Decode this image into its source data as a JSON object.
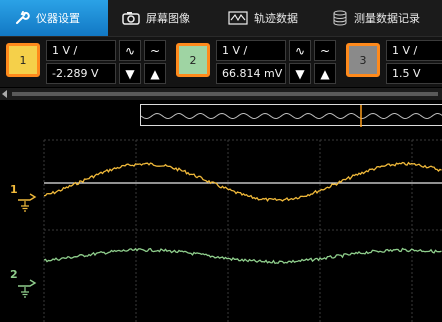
{
  "tabs": [
    {
      "label": "仪器设置",
      "icon": "wrench-icon",
      "active": true
    },
    {
      "label": "屏幕图像",
      "icon": "camera-icon",
      "active": false
    },
    {
      "label": "轨迹数据",
      "icon": "waveform-icon",
      "active": false
    },
    {
      "label": "测量数据记录",
      "icon": "database-icon",
      "active": false
    }
  ],
  "channels": [
    {
      "number": "1",
      "scale": "1 V /",
      "offset": "-2.289 V",
      "color": "#f5d04a",
      "border": "#ff8a1c"
    },
    {
      "number": "2",
      "scale": "1 V /",
      "offset": "66.814 mV",
      "color": "#9fd4a3",
      "border": "#ff8a1c"
    },
    {
      "number": "3",
      "scale": "1 V /",
      "offset": "1.5 V",
      "color": "#8a8a8a",
      "border": "#ff8a1c"
    }
  ],
  "controls": {
    "sine_glyph": "∿",
    "tilde_glyph": "~",
    "down_glyph": "▼",
    "up_glyph": "▲"
  },
  "scope": {
    "ch1_marker": "1",
    "ch2_marker": "2",
    "ch1_color": "#f0b93a",
    "ch2_color": "#8fce8c",
    "grid_color": "#3a3a3a",
    "cursor_color": "#ff9f1c"
  }
}
